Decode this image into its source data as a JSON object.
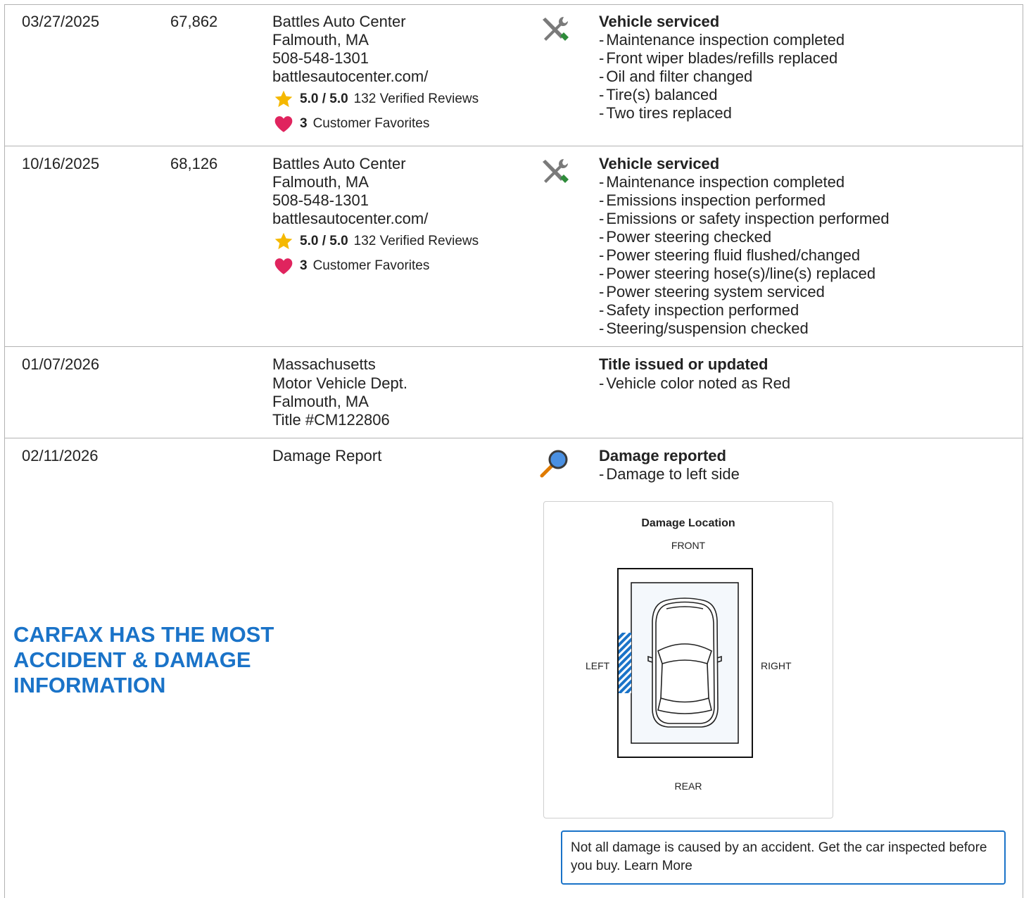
{
  "records": [
    {
      "date": "03/27/2025",
      "mileage": "67,862",
      "source": [
        "Battles Auto Center",
        "Falmouth, MA",
        "508-548-1301",
        "battlesautocenter.com/"
      ],
      "rating": "5.0 / 5.0",
      "reviews": "132 Verified Reviews",
      "favorites_count": "3",
      "favorites_label": "Customer Favorites",
      "icon": "wrench-screwdriver-icon",
      "detail_title": "Vehicle serviced",
      "details": [
        "Maintenance inspection completed",
        "Front wiper blades/refills replaced",
        "Oil and filter changed",
        "Tire(s) balanced",
        "Two tires replaced"
      ]
    },
    {
      "date": "10/16/2025",
      "mileage": "68,126",
      "source": [
        "Battles Auto Center",
        "Falmouth, MA",
        "508-548-1301",
        "battlesautocenter.com/"
      ],
      "rating": "5.0 / 5.0",
      "reviews": "132 Verified Reviews",
      "favorites_count": "3",
      "favorites_label": "Customer Favorites",
      "icon": "wrench-screwdriver-icon",
      "detail_title": "Vehicle serviced",
      "details": [
        "Maintenance inspection completed",
        "Emissions inspection performed",
        "Emissions or safety inspection performed",
        "Power steering checked",
        "Power steering fluid flushed/changed",
        "Power steering hose(s)/line(s) replaced",
        "Power steering system serviced",
        "Safety inspection performed",
        "Steering/suspension checked"
      ]
    },
    {
      "date": "01/07/2026",
      "mileage": "",
      "source": [
        "Massachusetts",
        "Motor Vehicle Dept.",
        "Falmouth, MA",
        "Title #CM122806"
      ],
      "detail_title": "Title issued or updated",
      "details": [
        "Vehicle color noted as Red"
      ]
    },
    {
      "date": "02/11/2026",
      "mileage": "",
      "source": [
        "Damage Report"
      ],
      "icon": "magnifier-icon",
      "detail_title": "Damage reported",
      "details": [
        "Damage to left side"
      ]
    }
  ],
  "promo": [
    "CARFAX HAS THE MOST",
    "ACCIDENT & DAMAGE",
    "INFORMATION"
  ],
  "damage_diagram": {
    "title": "Damage Location",
    "front": "FRONT",
    "rear": "REAR",
    "left": "LEFT",
    "right": "RIGHT",
    "damaged_side": "left"
  },
  "notice": "Not all damage is caused by an accident. Get the car inspected before you buy. Learn More",
  "colors": {
    "accent": "#1a73c8",
    "star": "#f5b800",
    "heart": "#e0245e",
    "border": "#b3b3b3"
  }
}
